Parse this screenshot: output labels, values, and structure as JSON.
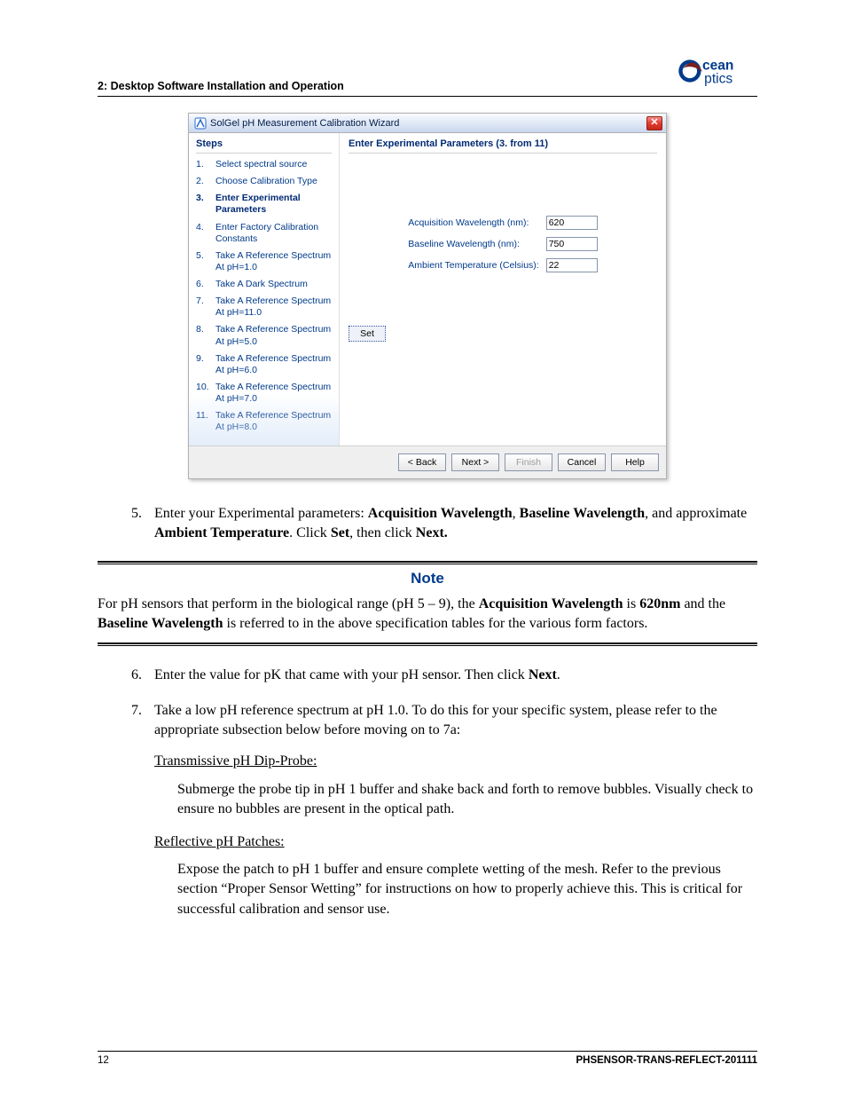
{
  "header": {
    "section_label": "2: Desktop Software Installation and Operation"
  },
  "logo": {
    "top": "cean",
    "bottom": "ptics"
  },
  "wizard": {
    "title": "SolGel pH Measurement Calibration Wizard",
    "steps_heading": "Steps",
    "main_heading": "Enter Experimental Parameters (3. from 11)",
    "steps": [
      {
        "n": "1.",
        "label": "Select spectral source"
      },
      {
        "n": "2.",
        "label": "Choose Calibration Type"
      },
      {
        "n": "3.",
        "label": "Enter Experimental Parameters",
        "active": true
      },
      {
        "n": "4.",
        "label": "Enter Factory Calibration Constants"
      },
      {
        "n": "5.",
        "label": "Take A Reference Spectrum At pH=1.0"
      },
      {
        "n": "6.",
        "label": "Take A Dark Spectrum"
      },
      {
        "n": "7.",
        "label": "Take A Reference Spectrum At pH=11.0"
      },
      {
        "n": "8.",
        "label": "Take A Reference Spectrum At pH=5.0"
      },
      {
        "n": "9.",
        "label": "Take A Reference Spectrum At pH=6.0"
      },
      {
        "n": "10.",
        "label": "Take A Reference Spectrum At pH=7.0"
      },
      {
        "n": "11.",
        "label": "Take A Reference Spectrum At pH=8.0"
      }
    ],
    "params": {
      "acq_label": "Acquisition Wavelength (nm):",
      "acq_value": "620",
      "base_label": "Baseline Wavelength (nm):",
      "base_value": "750",
      "temp_label": "Ambient Temperature (Celsius):",
      "temp_value": "22"
    },
    "set_label": "Set",
    "buttons": {
      "back": "< Back",
      "next": "Next >",
      "finish": "Finish",
      "cancel": "Cancel",
      "help": "Help"
    }
  },
  "body": {
    "item5": {
      "n": "5.",
      "t1": "Enter your Experimental parameters: ",
      "b1": "Acquisition Wavelength",
      "t2": ", ",
      "b2": "Baseline Wavelength",
      "t3": ", and approximate ",
      "b3": "Ambient Temperature",
      "t4": ". Click ",
      "b4": "Set",
      "t5": ", then click ",
      "b5": "Next."
    },
    "note_title": "Note",
    "note": {
      "t1": "For pH sensors that perform in the biological range (pH 5 – 9), the ",
      "b1": "Acquisition Wavelength",
      "t2": " is ",
      "b2": "620nm",
      "t3": " and the ",
      "b3": "Baseline Wavelength",
      "t4": " is referred to in the above specification tables for the various form factors."
    },
    "item6": {
      "n": "6.",
      "t1": "Enter the value for pK that came with your pH sensor. Then click ",
      "b1": "Next",
      "t2": "."
    },
    "item7": {
      "n": "7.",
      "text": "Take a low pH reference spectrum at pH 1.0. To do this for your specific system, please refer to the appropriate subsection below before moving on to 7a:",
      "sub1_title": "Transmissive pH Dip-Probe:",
      "sub1_body": "Submerge the probe tip in pH 1 buffer and shake back and forth to remove bubbles. Visually check to ensure no bubbles are present in the optical path.",
      "sub2_title": "Reflective pH Patches:",
      "sub2_body": "Expose the patch to pH 1 buffer and ensure complete wetting of the mesh. Refer to the previous section “Proper Sensor Wetting” for instructions on how to properly achieve this. This is critical for successful calibration and sensor use."
    }
  },
  "footer": {
    "page": "12",
    "doc": "PHSENSOR-TRANS-REFLECT-201111"
  }
}
